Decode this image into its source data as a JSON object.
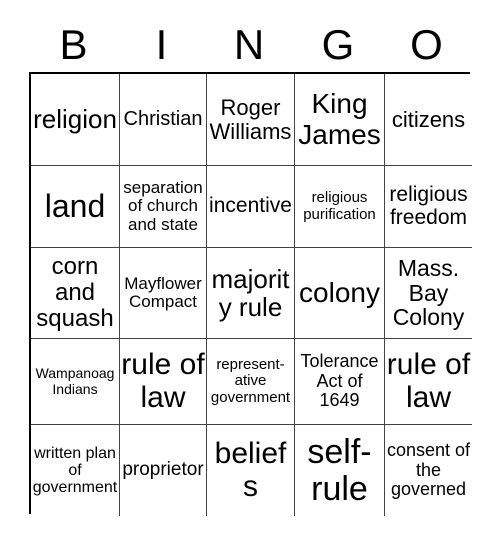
{
  "card": {
    "title_letters": [
      "B",
      "I",
      "N",
      "G",
      "O"
    ],
    "grid_size": "5x5",
    "colors": {
      "background": "#ffffff",
      "text": "#000000",
      "grid_line": "#444444",
      "outer_border": "#000000"
    },
    "rows": [
      [
        {
          "text": "religion",
          "size": "fs-26"
        },
        {
          "text": "Christian",
          "size": "fs-20"
        },
        {
          "text": "Roger Williams",
          "size": "fs-22"
        },
        {
          "text": "King James",
          "size": "fs-28"
        },
        {
          "text": "citizens",
          "size": "fs-22"
        }
      ],
      [
        {
          "text": "land",
          "size": "fs-32"
        },
        {
          "text": "separation of church and state",
          "size": "fs-17"
        },
        {
          "text": "incentive",
          "size": "fs-21"
        },
        {
          "text": "religious purification",
          "size": "fs-15"
        },
        {
          "text": "religious freedom",
          "size": "fs-21"
        }
      ],
      [
        {
          "text": "corn and squash",
          "size": "fs-24"
        },
        {
          "text": "Mayflower Compact",
          "size": "fs-17"
        },
        {
          "text": "majority rule",
          "size": "fs-26"
        },
        {
          "text": "colony",
          "size": "fs-28"
        },
        {
          "text": "Mass. Bay Colony",
          "size": "fs-23"
        }
      ],
      [
        {
          "text": "Wampanoag Indians",
          "size": "fs-14"
        },
        {
          "text": "rule of law",
          "size": "fs-30"
        },
        {
          "text": "represent- ative government",
          "size": "fs-15"
        },
        {
          "text": "Tolerance Act of 1649",
          "size": "fs-18"
        },
        {
          "text": "rule of law",
          "size": "fs-30"
        }
      ],
      [
        {
          "text": "written plan of government",
          "size": "fs-16"
        },
        {
          "text": "proprietor",
          "size": "fs-19"
        },
        {
          "text": "beliefs",
          "size": "fs-30"
        },
        {
          "text": "self- rule",
          "size": "fs-34"
        },
        {
          "text": "consent of the governed",
          "size": "fs-18"
        }
      ]
    ]
  }
}
